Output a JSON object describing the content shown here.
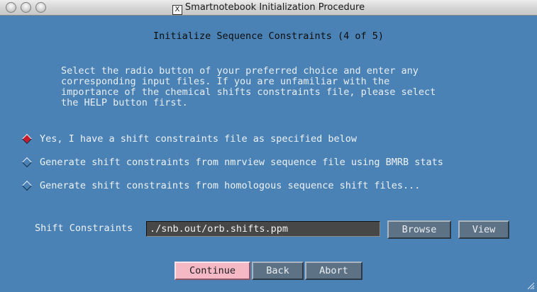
{
  "window": {
    "title": "Smartnotebook Initialization Procedure",
    "x11_glyph": "X"
  },
  "heading": "Initialize Sequence Constraints (4 of 5)",
  "instructions": [
    "Select the radio button of your preferred choice and enter any",
    "corresponding input files. If you are unfamiliar with the",
    "importance of the chemical shifts constraints file, please select",
    "the HELP button first."
  ],
  "options": [
    {
      "label": "Yes, I have a shift constraints file as specified below",
      "selected": true
    },
    {
      "label": "Generate shift constraints from nmrview sequence file using BMRB stats",
      "selected": false
    },
    {
      "label": "Generate shift constraints from homologous sequence shift files...",
      "selected": false
    }
  ],
  "field": {
    "label": "Shift Constraints",
    "value": "./snb.out/orb.shifts.ppm"
  },
  "buttons": {
    "browse": "Browse",
    "view": "View",
    "continue": "Continue",
    "back": "Back",
    "abort": "Abort"
  },
  "colors": {
    "background": "#4a82b5",
    "selected_radio": "#c51d2b",
    "primary_button": "#f5b8c5",
    "button": "#5e7285"
  }
}
